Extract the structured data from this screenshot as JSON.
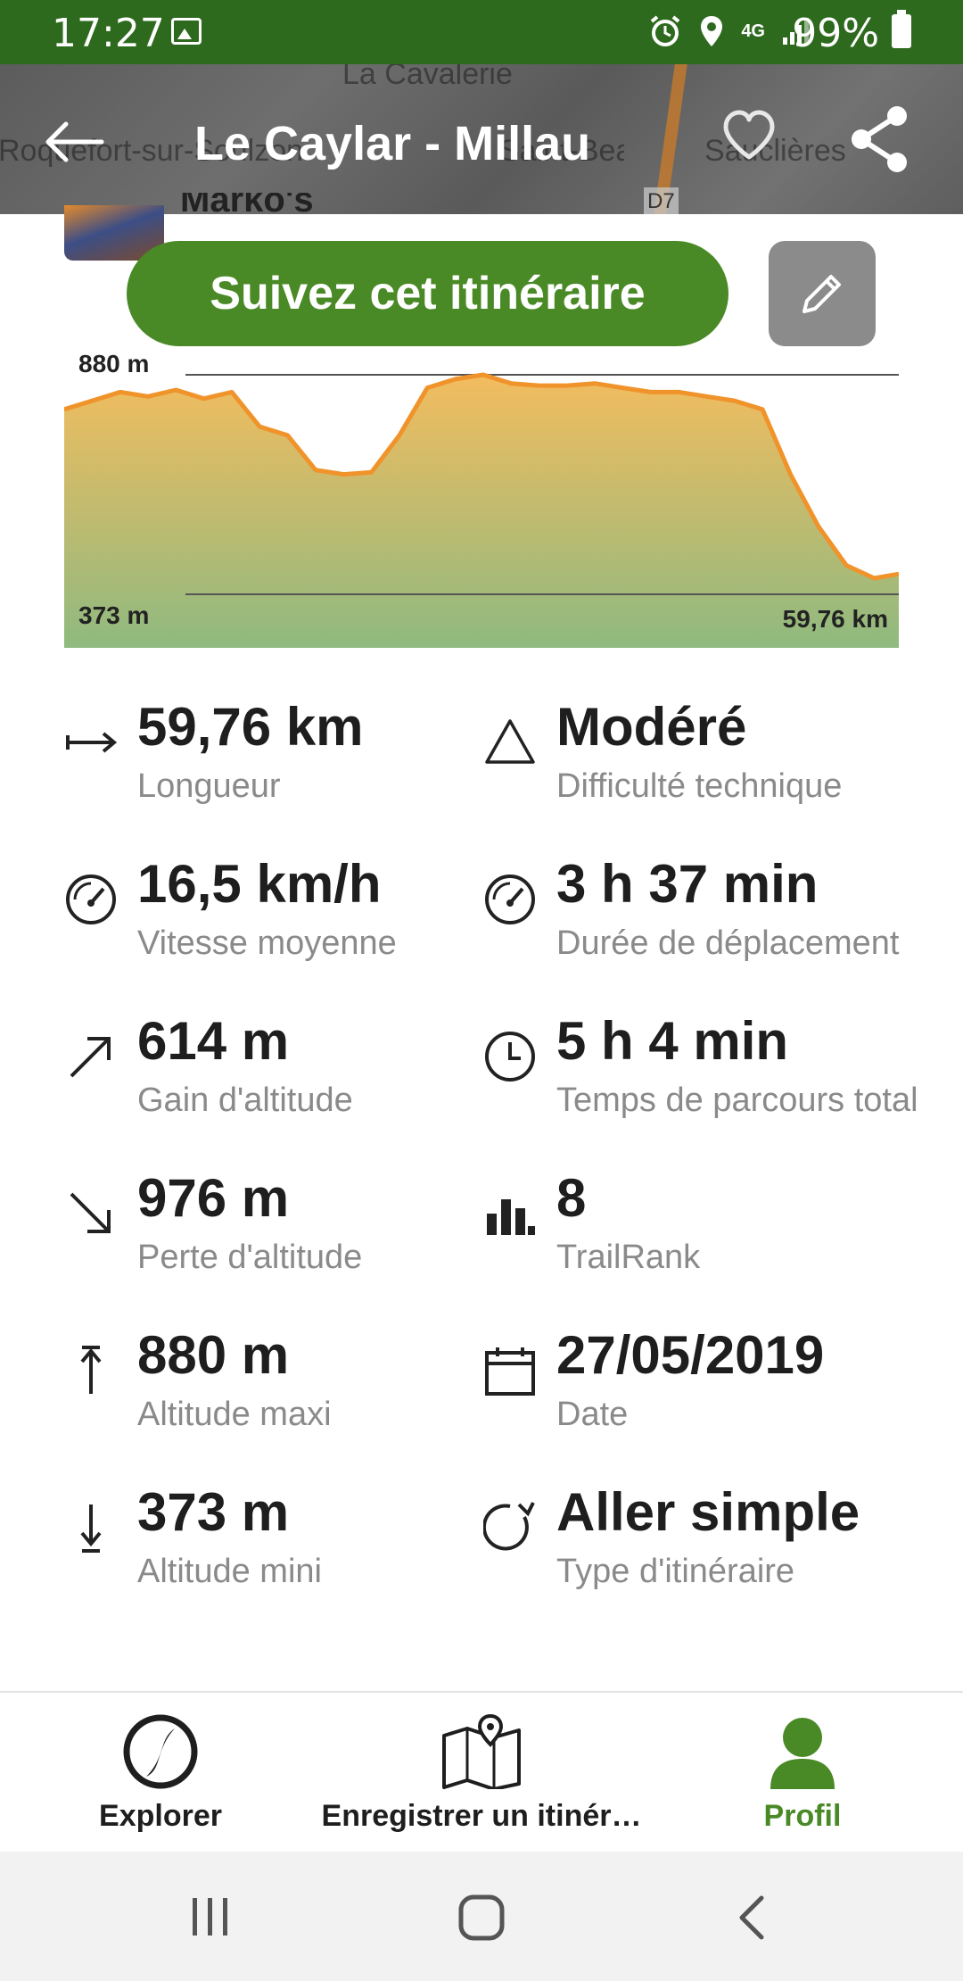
{
  "status_bar": {
    "time": "17:27",
    "network": "4G",
    "battery": "99%"
  },
  "header": {
    "title": "Le Caylar - Millau",
    "map_labels": [
      "La Cavalerie",
      "Roquefort-sur-Soulzon",
      "Saint-Beaulize",
      "Sauclières",
      "D7"
    ]
  },
  "author": {
    "name": "Marko's"
  },
  "actions": {
    "follow_label": "Suivez cet itinéraire"
  },
  "chart_data": {
    "type": "area",
    "x": [
      0,
      2,
      4,
      6,
      8,
      10,
      12,
      14,
      16,
      18,
      20,
      22,
      24,
      26,
      28,
      30,
      32,
      34,
      36,
      38,
      40,
      42,
      44,
      46,
      48,
      50,
      52,
      54,
      56,
      58,
      59.76
    ],
    "values": [
      800,
      820,
      840,
      830,
      845,
      825,
      840,
      760,
      740,
      660,
      650,
      655,
      740,
      850,
      870,
      880,
      860,
      855,
      855,
      860,
      850,
      840,
      840,
      830,
      820,
      800,
      650,
      530,
      440,
      410,
      420
    ],
    "ylim": [
      373,
      880
    ],
    "xlim": [
      0,
      59.76
    ],
    "max_label": "880 m",
    "min_label": "373 m",
    "distance_label": "59,76 km",
    "line_color": "#f0932b",
    "fill_top_color": "#f3bc5e",
    "fill_bottom_color": "#8fba80"
  },
  "stats": [
    {
      "icon": "length-arrow-icon",
      "value": "59,76 km",
      "label": "Longueur"
    },
    {
      "icon": "difficulty-triangle-icon",
      "value": "Modéré",
      "label": "Difficulté technique"
    },
    {
      "icon": "speed-gauge-icon",
      "value": "16,5 km/h",
      "label": "Vitesse moyenne"
    },
    {
      "icon": "gauge-icon",
      "value": "3 h 37 min",
      "label": "Durée de déplacement"
    },
    {
      "icon": "elevation-gain-icon",
      "value": "614 m",
      "label": "Gain d'altitude"
    },
    {
      "icon": "clock-icon",
      "value": "5 h 4 min",
      "label": "Temps de parcours total"
    },
    {
      "icon": "elevation-loss-icon",
      "value": "976 m",
      "label": "Perte d'altitude"
    },
    {
      "icon": "trailrank-bars-icon",
      "value": "8",
      "label": "TrailRank"
    },
    {
      "icon": "max-altitude-icon",
      "value": "880 m",
      "label": "Altitude maxi"
    },
    {
      "icon": "calendar-icon",
      "value": "27/05/2019",
      "label": "Date"
    },
    {
      "icon": "min-altitude-icon",
      "value": "373 m",
      "label": "Altitude mini"
    },
    {
      "icon": "one-way-icon",
      "value": "Aller simple",
      "label": "Type d'itinéraire"
    }
  ],
  "bottom_nav": [
    {
      "label": "Explorer",
      "icon": "explore-icon"
    },
    {
      "label": "Enregistrer un itinér…",
      "icon": "record-map-icon"
    },
    {
      "label": "Profil",
      "icon": "profile-icon",
      "active": true
    }
  ],
  "colors": {
    "brand_green": "#4a8a26",
    "status_bar": "#2e6a1e",
    "muted_text": "#8a8a8a"
  }
}
